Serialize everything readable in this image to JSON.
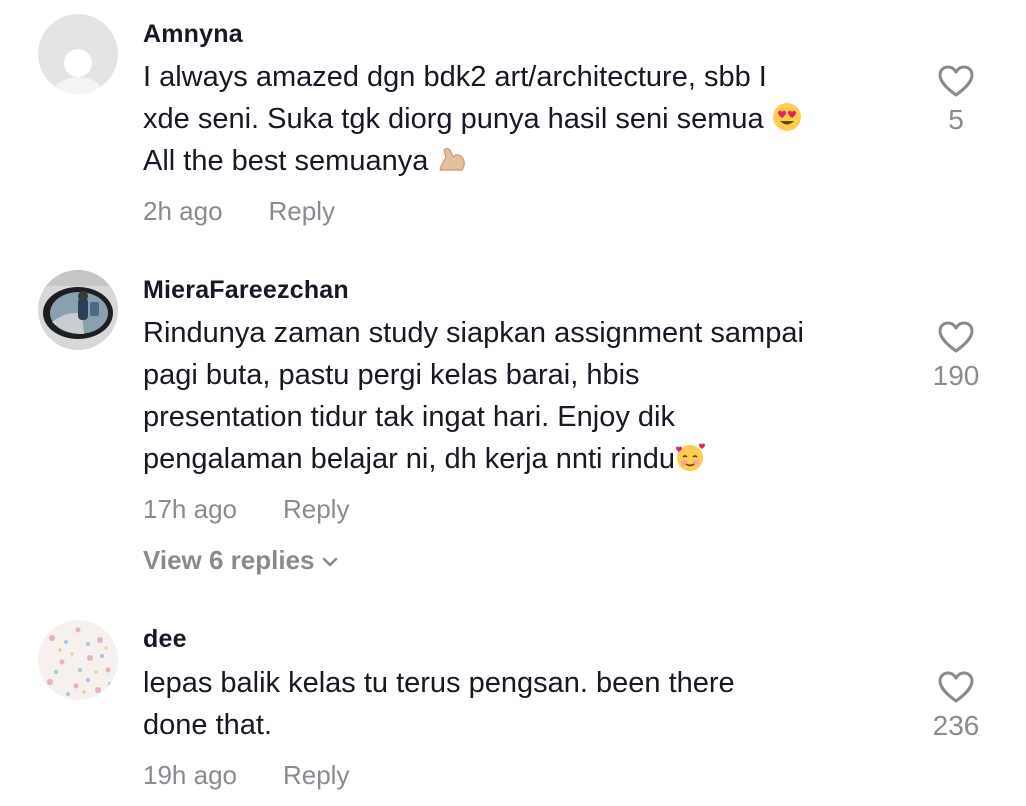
{
  "comments": [
    {
      "username": "Amnyna",
      "lines": [
        "I always amazed dgn bdk2 art/architecture, sbb I",
        "xde seni. Suka tgk diorg punya hasil seni semua ",
        "All the best semuanya "
      ],
      "time": "2h ago",
      "reply_label": "Reply",
      "likes": "5",
      "avatar": "default-avatar-icon"
    },
    {
      "username": "MieraFareezchan",
      "lines": [
        "Rindunya zaman study siapkan assignment sampai",
        "pagi buta, pastu pergi kelas barai, hbis",
        "presentation tidur tak ingat hari. Enjoy dik",
        "pengalaman belajar ni, dh kerja nnti rindu"
      ],
      "time": "17h ago",
      "reply_label": "Reply",
      "likes": "190",
      "view_replies": "View 6 replies",
      "avatar": "car-mirror-photo"
    },
    {
      "username": "dee",
      "lines": [
        "lepas balik kelas tu terus pengsan. been there",
        "done that."
      ],
      "time": "19h ago",
      "reply_label": "Reply",
      "likes": "236",
      "avatar": "floral-pattern-photo"
    }
  ],
  "colors": {
    "text": "#161823",
    "secondary": "#8a8b91",
    "background": "#ffffff"
  }
}
